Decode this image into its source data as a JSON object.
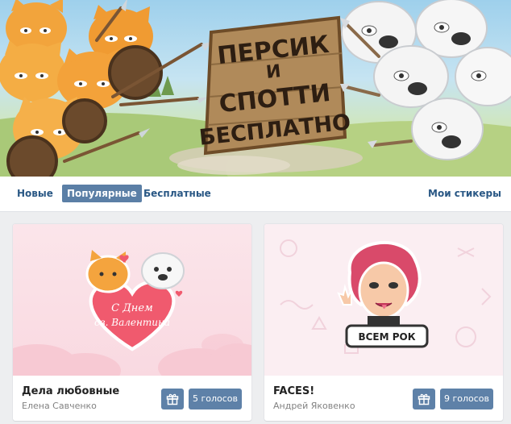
{
  "banner": {
    "sign_lines": [
      "ПЕРСИК",
      "И",
      "СПОТТИ",
      "БЕСПЛАТНО"
    ],
    "colors": {
      "sky": "#9ed0ec",
      "grass": "#b7cf86",
      "cat": "#f2a43c",
      "dog": "#f4f4f4",
      "sign": "#b08a5a"
    }
  },
  "tabs": {
    "new": "Новые",
    "popular": "Популярные",
    "free": "Бесплатные",
    "mine": "Мои стикеры",
    "active": "popular",
    "accent": "#5b7fa6"
  },
  "cards": [
    {
      "title": "Дела любовные",
      "author": "Елена Савченко",
      "votes": "5 голосов",
      "heart_text_1": "С Днем",
      "heart_text_2": "св. Валентина",
      "gift_icon": "gift-icon"
    },
    {
      "title": "FACES!",
      "author": "Андрей Яковенко",
      "votes": "9 голосов",
      "badge_text": "ВСЕМ РОК",
      "gift_icon": "gift-icon"
    }
  ]
}
